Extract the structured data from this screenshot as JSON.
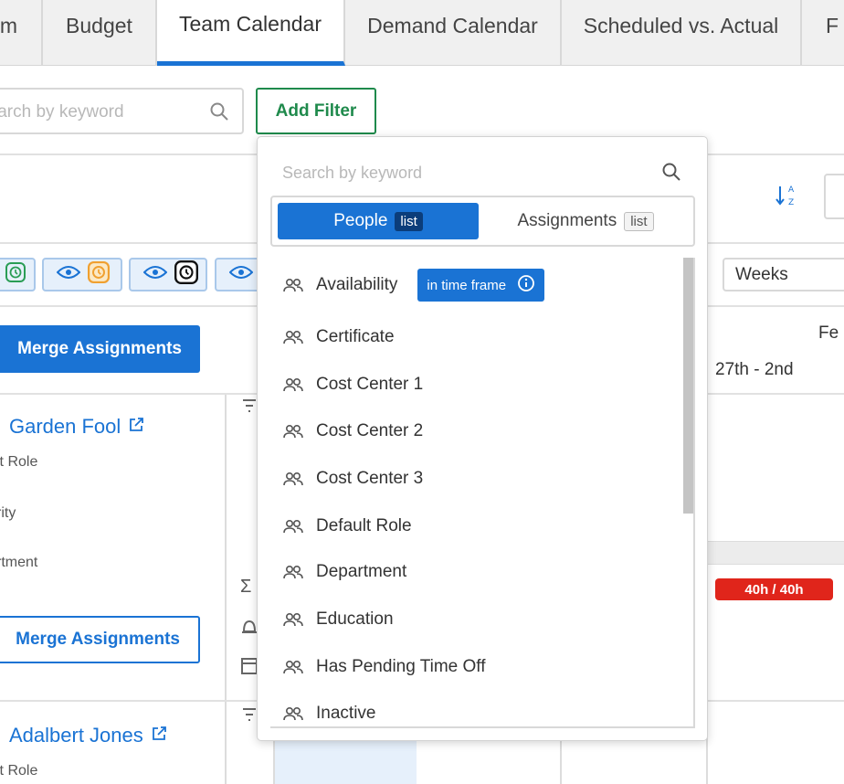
{
  "tabs": [
    {
      "label": "m"
    },
    {
      "label": "Budget"
    },
    {
      "label": "Team Calendar"
    },
    {
      "label": "Demand Calendar"
    },
    {
      "label": "Scheduled vs. Actual"
    },
    {
      "label": "F"
    }
  ],
  "toolbar": {
    "search_placeholder": "Search by keyword",
    "add_filter_label": "Add Filter"
  },
  "view": {
    "weeks_label": "Weeks"
  },
  "merge": {
    "primary_label": "Merge Assignments",
    "secondary_label": "Merge Assignments"
  },
  "people": [
    {
      "name": "Garden Fool",
      "fields": [
        "lt Role",
        "rity",
        "rtment"
      ]
    },
    {
      "name": "Adalbert Jones",
      "fields": [
        "lt Role"
      ]
    }
  ],
  "calendar": {
    "month_partial": "Fe",
    "week_range": "27th - 2nd",
    "hours_badge": "40h / 40h"
  },
  "filter_dropdown": {
    "search_placeholder": "Search by keyword",
    "toggle": {
      "people_label": "People",
      "people_badge": "list",
      "assignments_label": "Assignments",
      "assignments_badge": "list"
    },
    "options": [
      {
        "label": "Availability",
        "badge": "in time frame"
      },
      {
        "label": "Certificate"
      },
      {
        "label": "Cost Center 1"
      },
      {
        "label": "Cost Center 2"
      },
      {
        "label": "Cost Center 3"
      },
      {
        "label": "Default Role"
      },
      {
        "label": "Department"
      },
      {
        "label": "Education"
      },
      {
        "label": "Has Pending Time Off"
      },
      {
        "label": "Inactive"
      }
    ]
  },
  "colors": {
    "accent": "#1a73d4",
    "green": "#1f8a4c",
    "danger": "#e0251b"
  }
}
